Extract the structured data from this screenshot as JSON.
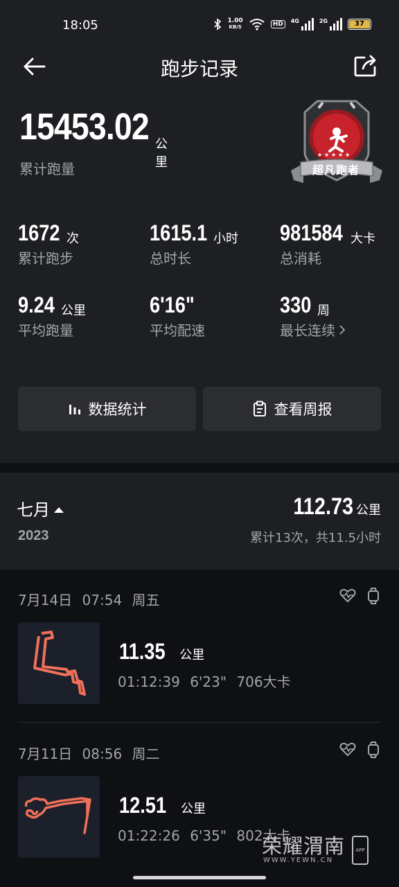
{
  "status_bar": {
    "time": "18:05",
    "net_speed_value": "1.00",
    "net_speed_unit": "KB/S",
    "hd_label": "HD",
    "net1_label": "4G",
    "net2_label": "2G",
    "battery_level": "37"
  },
  "header": {
    "title": "跑步记录"
  },
  "summary": {
    "total_distance": "15453.02",
    "total_unit": "公里",
    "total_label": "累计跑量",
    "badge_text": "超凡跑者"
  },
  "stats": [
    {
      "value": "1672",
      "unit": "次",
      "label": "累计跑步"
    },
    {
      "value": "1615.1",
      "unit": "小时",
      "label": "总时长"
    },
    {
      "value": "981584",
      "unit": "大卡",
      "label": "总消耗"
    },
    {
      "value": "9.24",
      "unit": "公里",
      "label": "平均跑量"
    },
    {
      "value": "6'16\"",
      "unit": "",
      "label": "平均配速"
    },
    {
      "value": "330",
      "unit": "周",
      "label": "最长连续"
    }
  ],
  "buttons": {
    "statistics": "数据统计",
    "weekly_report": "查看周报"
  },
  "month": {
    "name": "七月",
    "year": "2023",
    "distance": "112.73",
    "unit": "公里",
    "summary": "累计13次，共11.5小时"
  },
  "records": [
    {
      "date": "7月14日",
      "time": "07:54",
      "weekday": "周五",
      "distance": "11.35",
      "unit": "公里",
      "duration": "01:12:39",
      "pace": "6'23\"",
      "calories": "706大卡"
    },
    {
      "date": "7月11日",
      "time": "08:56",
      "weekday": "周二",
      "distance": "12.51",
      "unit": "公里",
      "duration": "01:22:26",
      "pace": "6'35\"",
      "calories": "802大卡"
    }
  ],
  "watermark": {
    "text": "荣耀渭南",
    "url": "WWW.YEWN.CN",
    "app": "APP"
  },
  "colors": {
    "background": "#0f1013",
    "panel": "#1d1f22",
    "button": "#2b2d31",
    "secondary_text": "#a3a5a9",
    "route": "#f0705a",
    "badge_red": "#c8232c"
  }
}
